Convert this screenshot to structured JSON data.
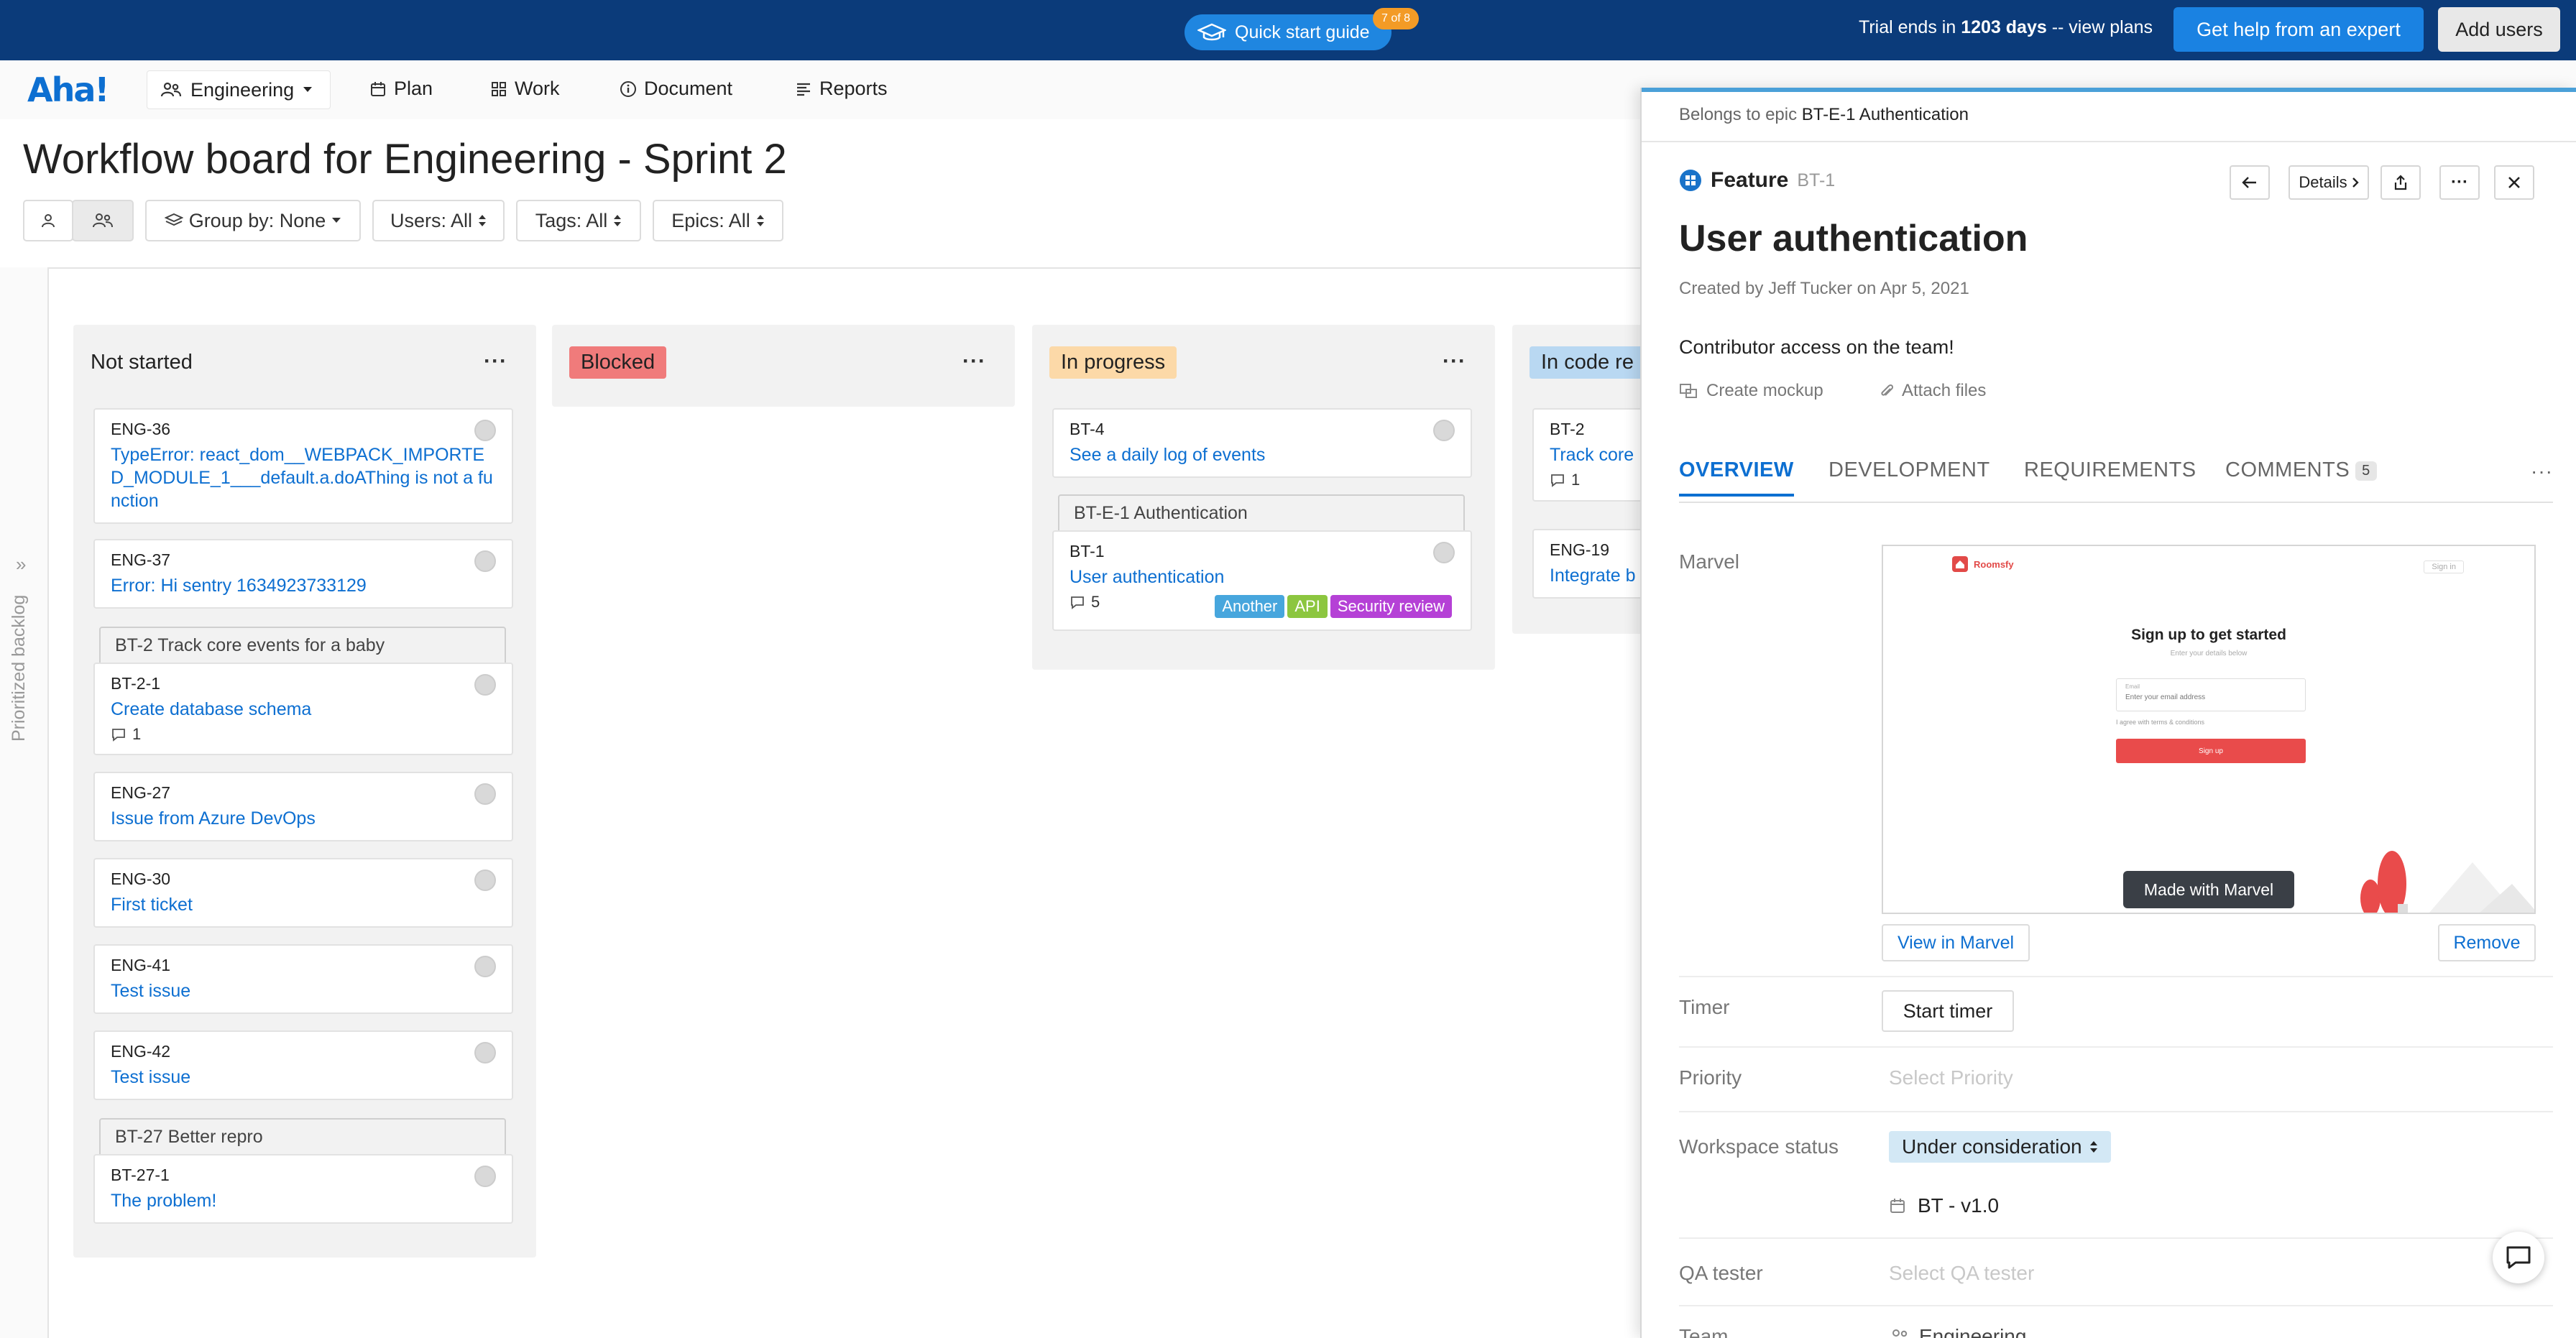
{
  "banner": {
    "quick_start": "Quick start guide",
    "quick_start_badge": "7 of 8",
    "trial_prefix": "Trial ends in",
    "trial_days": "1203 days",
    "trial_suffix": "-- view plans",
    "expert_button": "Get help from an expert",
    "add_users_button": "Add users"
  },
  "nav": {
    "logo": "Aha!",
    "workspace": "Engineering",
    "items": [
      "Plan",
      "Work",
      "Document",
      "Reports"
    ]
  },
  "page": {
    "title": "Workflow board for Engineering - Sprint 2",
    "group_by": "Group by: None",
    "users": "Users: All",
    "tags": "Tags: All",
    "epics": "Epics: All",
    "backlog_label": "Prioritized backlog"
  },
  "columns": [
    {
      "name": "Not started",
      "pill_color": "",
      "cards": [
        {
          "id": "ENG-36",
          "title": "TypeError: react_dom__WEBPACK_IMPORTED_MODULE_1___default.a.doAThing is not a function"
        },
        {
          "id": "ENG-37",
          "title": "Error: Hi sentry 1634923733129"
        },
        {
          "epic": "BT-2 Track core events for a baby"
        },
        {
          "id": "BT-2-1",
          "title": "Create database schema",
          "comments": "1"
        },
        {
          "id": "ENG-27",
          "title": "Issue from Azure DevOps"
        },
        {
          "id": "ENG-30",
          "title": "First ticket"
        },
        {
          "id": "ENG-41",
          "title": "Test issue"
        },
        {
          "id": "ENG-42",
          "title": "Test issue"
        },
        {
          "epic": "BT-27 Better repro"
        },
        {
          "id": "BT-27-1",
          "title": "The problem!"
        }
      ]
    },
    {
      "name": "Blocked",
      "pill_color": "#f07b7b",
      "cards": []
    },
    {
      "name": "In progress",
      "pill_color": "#fcd9a8",
      "cards": [
        {
          "id": "BT-4",
          "title": "See a daily log of events"
        },
        {
          "epic": "BT-E-1 Authentication"
        },
        {
          "id": "BT-1",
          "title": "User authentication",
          "comments": "5",
          "tags": [
            {
              "label": "Another",
              "color": "#47a6dd"
            },
            {
              "label": "API",
              "color": "#8cc63f"
            },
            {
              "label": "Security review",
              "color": "#b541d6"
            }
          ]
        }
      ]
    },
    {
      "name": "In code re",
      "pill_color": "#b9d8f2",
      "cards": [
        {
          "id": "BT-2",
          "title": "Track core",
          "comments": "1"
        },
        {
          "id": "ENG-19",
          "title": "Integrate b"
        }
      ]
    }
  ],
  "drawer": {
    "belongs_prefix": "Belongs to epic",
    "belongs_epic": "BT-E-1 Authentication",
    "type": "Feature",
    "record_id": "BT-1",
    "details_button": "Details",
    "title": "User authentication",
    "created": "Created by Jeff Tucker on Apr 5, 2021",
    "description": "Contributor access on the team!",
    "create_mockup": "Create mockup",
    "attach_files": "Attach files",
    "tabs": [
      "OVERVIEW",
      "DEVELOPMENT",
      "REQUIREMENTS",
      "COMMENTS"
    ],
    "comments_count": "5",
    "fields": {
      "marvel_label": "Marvel",
      "view_in_marvel": "View in Marvel",
      "remove": "Remove",
      "timer_label": "Timer",
      "start_timer": "Start timer",
      "priority_label": "Priority",
      "priority_placeholder": "Select Priority",
      "workspace_status_label": "Workspace status",
      "workspace_status": "Under consideration",
      "release": "BT - v1.0",
      "qa_label": "QA tester",
      "qa_placeholder": "Select QA tester",
      "team_label": "Team",
      "team_value": "Engineering"
    },
    "marvel_preview": {
      "brand": "Roomsfy",
      "sign_in": "Sign in",
      "heading": "Sign up to get started",
      "subheading": "Enter your details below",
      "email_label": "Email",
      "email_placeholder": "Enter your email address",
      "terms": "I agree with terms & conditions",
      "button": "Sign up",
      "made_with": "Made with Marvel"
    }
  },
  "colors": {
    "banner": "#0b3b7a",
    "accent": "#0d6fd1",
    "blocked": "#f07b7b",
    "in_progress": "#fcd9a8",
    "in_code_review": "#b9d8f2"
  }
}
